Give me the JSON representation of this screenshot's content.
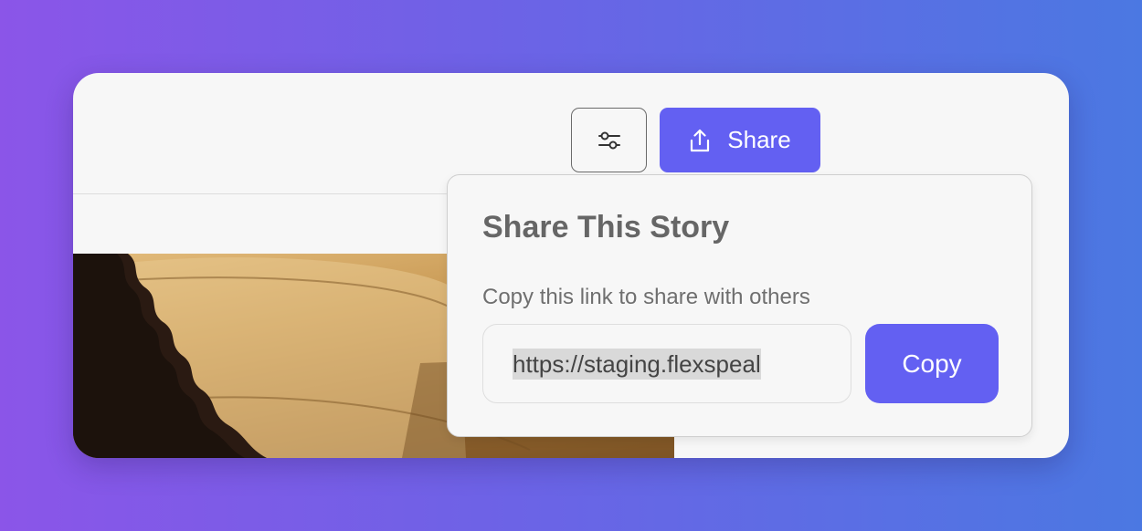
{
  "toolbar": {
    "settings_icon": "sliders-icon",
    "share_label": "Share",
    "share_icon": "upload-icon"
  },
  "share_popover": {
    "title": "Share This Story",
    "description": "Copy this link to share with others",
    "link_value": "https://staging.flexspeal",
    "copy_label": "Copy"
  },
  "colors": {
    "accent": "#6360f2",
    "background_gradient_start": "#8b55e8",
    "background_gradient_end": "#4b78e2",
    "card": "#f7f7f7"
  }
}
